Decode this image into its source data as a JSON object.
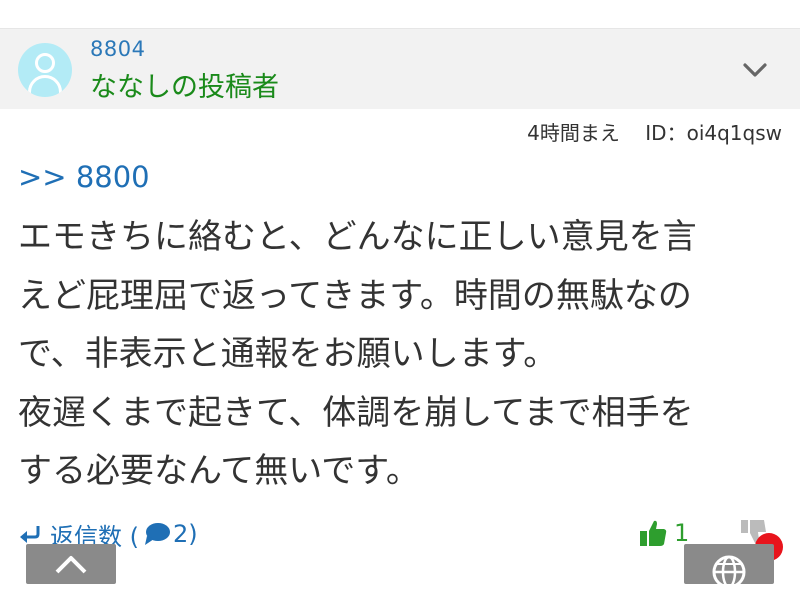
{
  "post": {
    "number": "8804",
    "poster_name": "ななしの投稿者",
    "time_ago": "4時間まえ",
    "id_label": "ID：oi4q1qsw",
    "reply_ref": ">> 8800",
    "body_lines": [
      "エモきちに絡むと、どんなに正しい意見を言",
      "えど屁理屈で返ってきます。時間の無駄なの",
      "で、非表示と通報をお願いします。",
      "夜遅くまで起きて、体調を崩してまで相手を",
      "する必要なんて無いです。"
    ]
  },
  "footer": {
    "replies_label": "返信数 (",
    "replies_count": "2)",
    "like_count": "1"
  },
  "icons": {
    "avatar": "user-avatar-icon",
    "expand": "chevron-down-icon",
    "reply": "reply-arrow-icon",
    "comment": "speech-bubble-icon",
    "like": "thumbs-up-icon",
    "dislike": "thumbs-down-icon",
    "scroll_top": "chevron-up-icon",
    "globe": "globe-icon"
  },
  "colors": {
    "post_number": "#2b78b8",
    "poster_name": "#1a8a1a",
    "link_blue": "#1f6fb5",
    "like_green": "#2e9e2e",
    "notification_red": "#e8141c",
    "avatar_bg": "#b3ebf6",
    "header_bg": "#f2f2f2"
  }
}
